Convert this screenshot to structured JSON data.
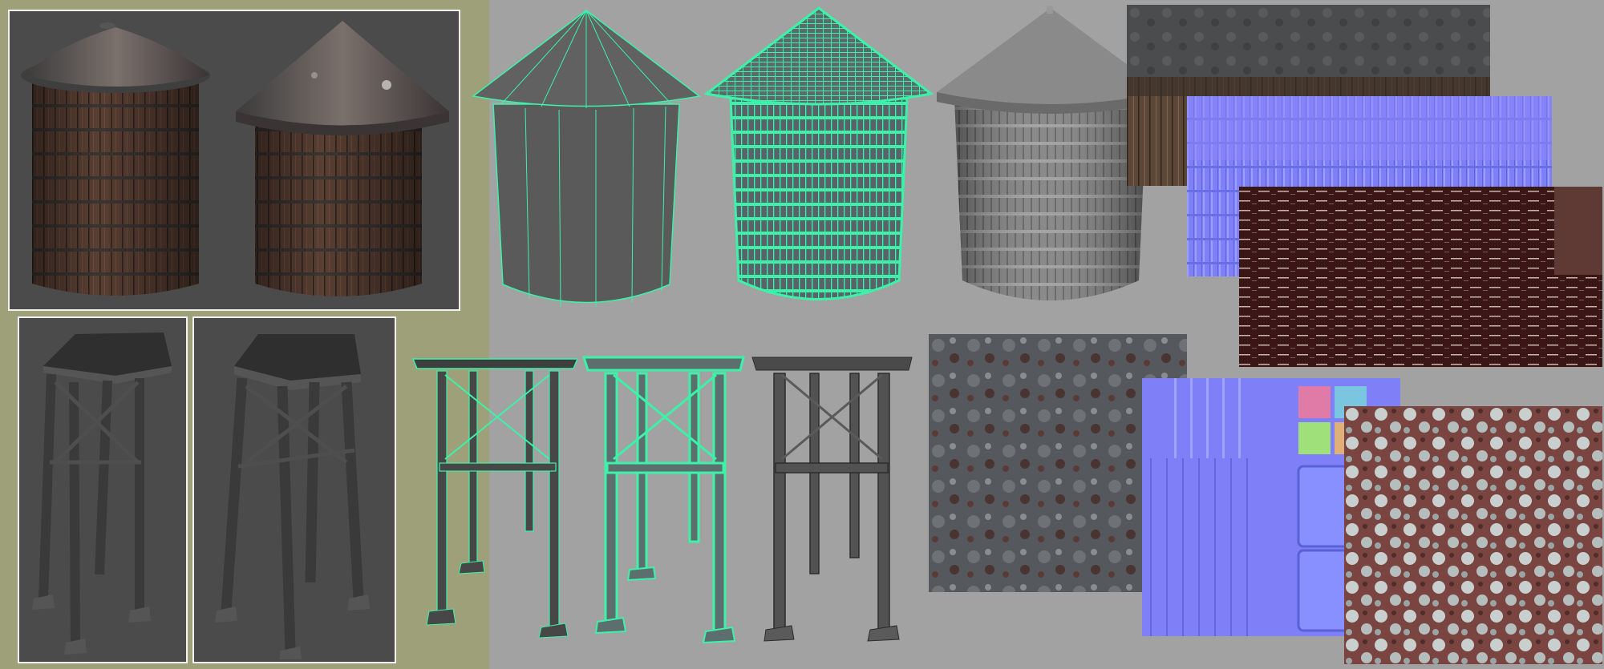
{
  "sheet": {
    "colors": {
      "left_panel": "#9ea07a",
      "canvas": "#a2a2a2",
      "render_bg": "#4b4b4b",
      "frame_border": "#f2f2f2",
      "wire_green": "#3cf2a8",
      "clay_gray": "#7d7d7d",
      "normal_purple": "#7f7ff7"
    },
    "panels": [
      {
        "name": "tank-render-panel",
        "icon": "water-tank-render"
      },
      {
        "name": "tower-render-panel-a",
        "icon": "tower-render"
      },
      {
        "name": "tower-render-panel-b",
        "icon": "tower-render"
      }
    ],
    "views": [
      "tank-lowpoly-wireframe",
      "tank-highpoly-wireframe",
      "tank-highpoly-clay",
      "tower-lowpoly-wireframe",
      "tower-highpoly-wireframe",
      "tower-highpoly-clay"
    ],
    "textures": [
      "tank-diffuse-map",
      "tank-normal-map",
      "tank-specular-map",
      "metal-rust-tile",
      "tower-normal-map",
      "rust-paint-tile"
    ]
  }
}
